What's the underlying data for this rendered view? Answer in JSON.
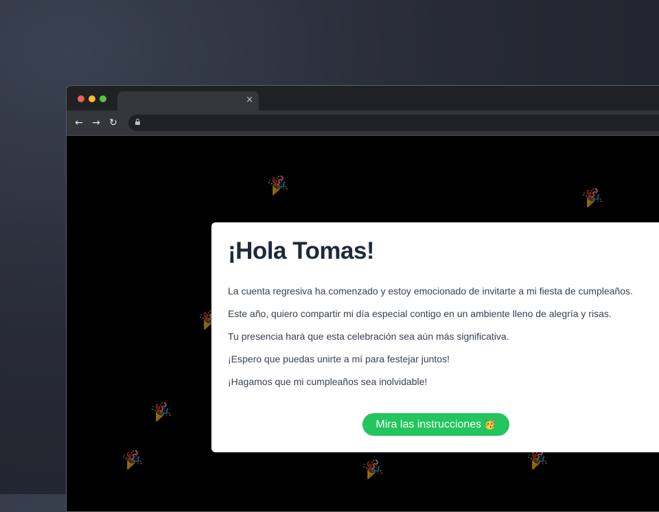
{
  "browser": {
    "tab_close": "×",
    "nav": {
      "back": "←",
      "forward": "→",
      "reload": "↻"
    }
  },
  "background": {
    "decoration_icon": "party-popper-icon",
    "decoration_glyph": "🎉"
  },
  "card": {
    "title": "¡Hola Tomas!",
    "paragraphs": [
      "La cuenta regresiva ha comenzado y estoy emocionado de invitarte a mi fiesta de cumpleaños.",
      "Este año, quiero compartir mi día especial contigo en un ambiente lleno de alegría y risas.",
      "Tu presencia hará que esta celebración sea aún más significativa.",
      "¡Espero que puedas unirte a mí para festejar juntos!",
      "¡Hagamos que mi cumpleaños sea inolvidable!"
    ],
    "button_label": "Mira las instrucciones",
    "button_emoji": "🥳",
    "button_color": "#22c55e"
  }
}
